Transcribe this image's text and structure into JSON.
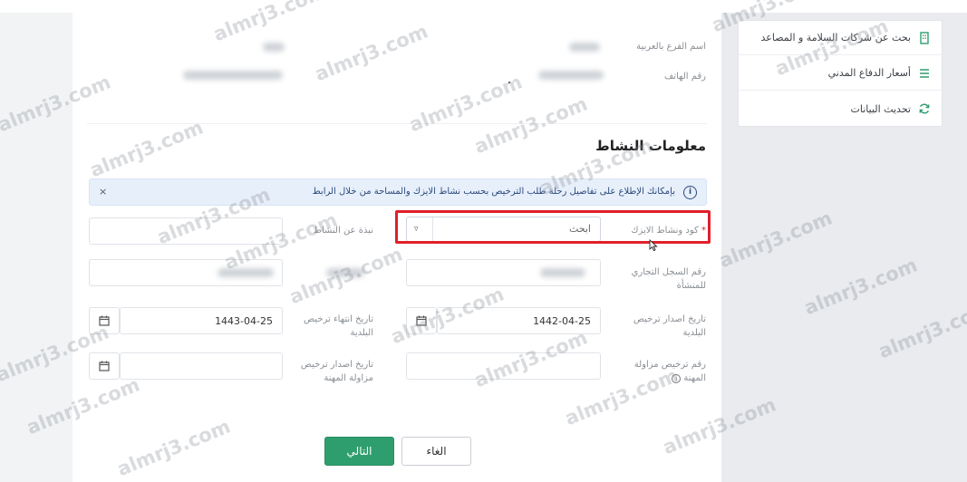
{
  "sidebar": {
    "items": [
      {
        "label": "بحث عن شركات السلامة و المصاعد",
        "icon": "building-icon"
      },
      {
        "label": "أسعار الدفاع المدني",
        "icon": "list-icon"
      },
      {
        "label": "تحديث البيانات",
        "icon": "refresh-icon"
      }
    ]
  },
  "branch": {
    "arabic_name_label": "اسم الفرع بالعربية",
    "phone_label": "رقم الهاتف"
  },
  "activity": {
    "title": "معلومات النشاط",
    "info_text": "بإمكانك الإطلاع على تفاصيل رحلة طلب الترخيص بحسب نشاط الايزك والمساحة من خلال الرابط",
    "info_close": "×",
    "code_label": "كود ونشاط الايزك",
    "required_mark": "*",
    "code_placeholder": "ابحث",
    "caret": "▿",
    "brief_label": "نبذة عن النشاط",
    "cr_label": "رقم السجل التجاري للمنشأة",
    "municipal_issue_label": "تاريخ اصدار ترخيص البلدية",
    "municipal_issue_value": "1442-04-25",
    "municipal_expiry_label": "تاريخ انتهاء ترخيص البلدية",
    "municipal_expiry_value": "1443-04-25",
    "practice_license_label": "رقم ترخيص مزاولة المهنة",
    "practice_issue_label": "تاريخ اصدار ترخيص مزاولة المهنة"
  },
  "buttons": {
    "next": "التالي",
    "cancel": "الغاء"
  },
  "watermark": "almrj3.com",
  "colors": {
    "primary_green": "#2f9e6e",
    "highlight_red": "#e0202a",
    "info_bg": "#e7effb"
  }
}
